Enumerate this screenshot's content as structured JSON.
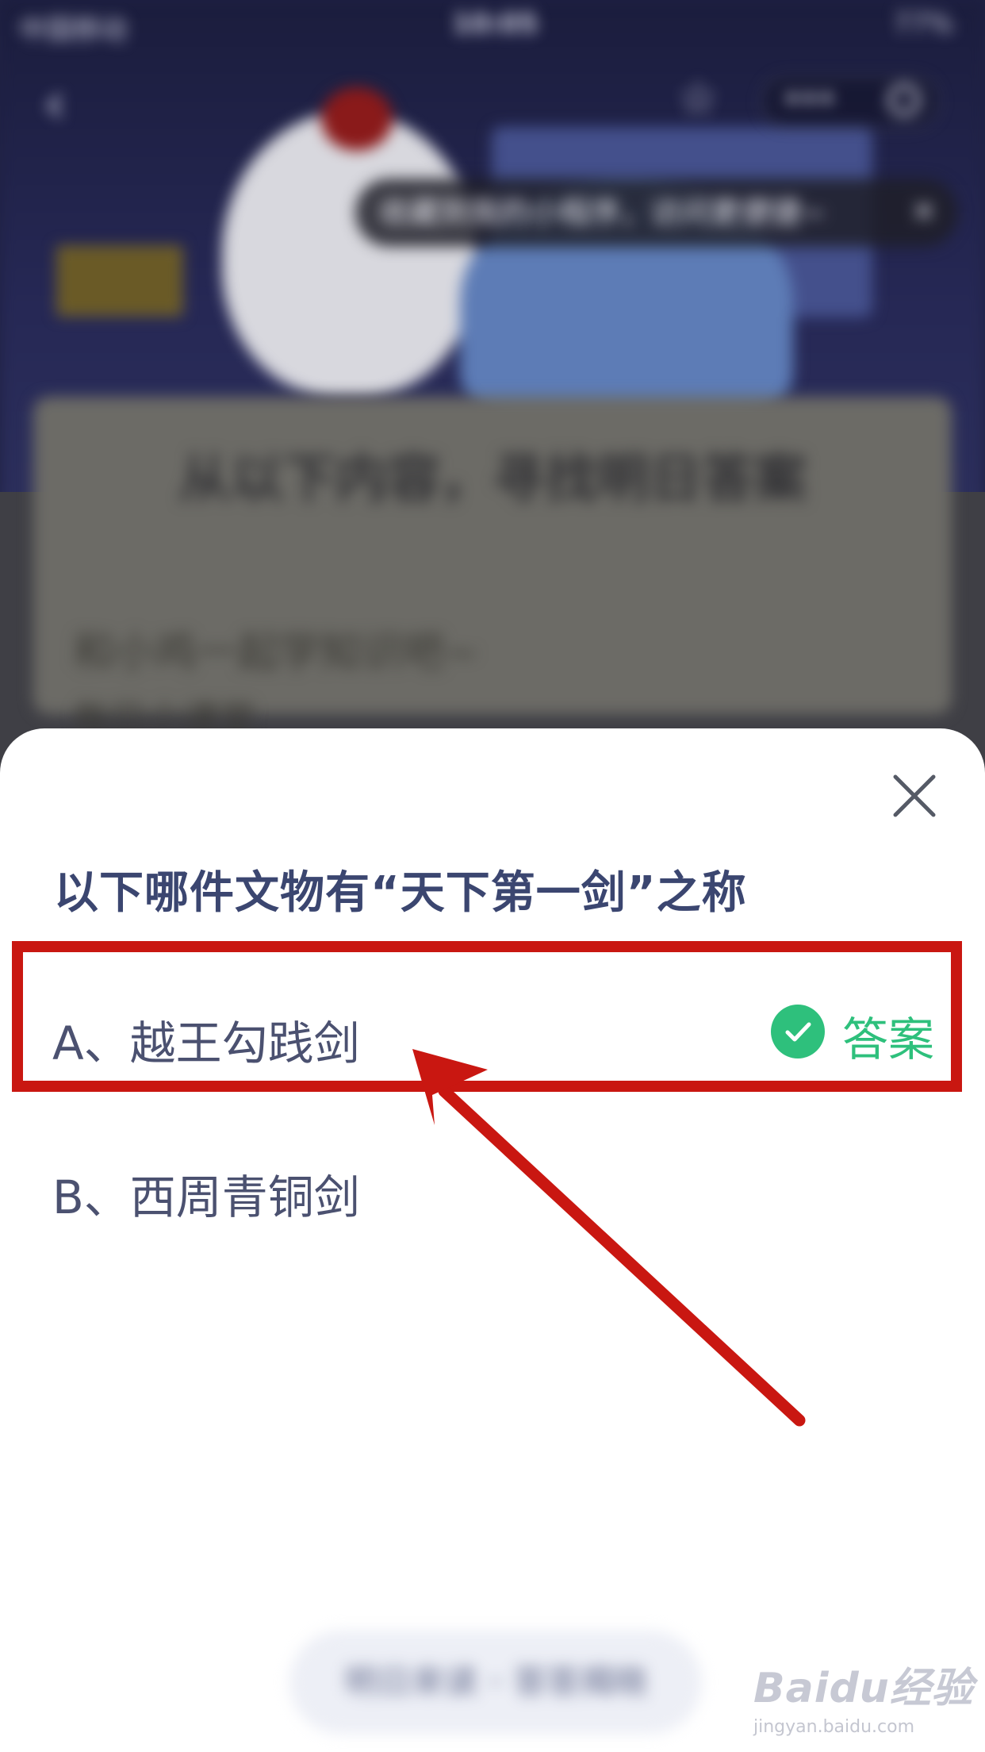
{
  "status_bar": {
    "carrier": "中国移动",
    "time": "10:05",
    "battery": "77%"
  },
  "background": {
    "tooltip": "收藏到我的小程序，访问更便捷~",
    "heading": "从以下内容，寻找明日答案",
    "sub_title": "和小鸡一起学知识吧~",
    "sub_label": "每日小课堂",
    "bottom_button": "明日来读 · 答答揭晓"
  },
  "quiz": {
    "question": "以下哪件文物有“天下第一剑”之称",
    "options": [
      {
        "label": "A、越王勾践剑",
        "correct": true
      },
      {
        "label": "B、西周青铜剑",
        "correct": false
      }
    ],
    "answer_label": "答案"
  },
  "watermark": {
    "main": "Baidu经验",
    "sub": "jingyan.baidu.com"
  },
  "colors": {
    "accent_green": "#2ec07c",
    "annotation_red": "#c91711",
    "question_text": "#3b4670"
  }
}
